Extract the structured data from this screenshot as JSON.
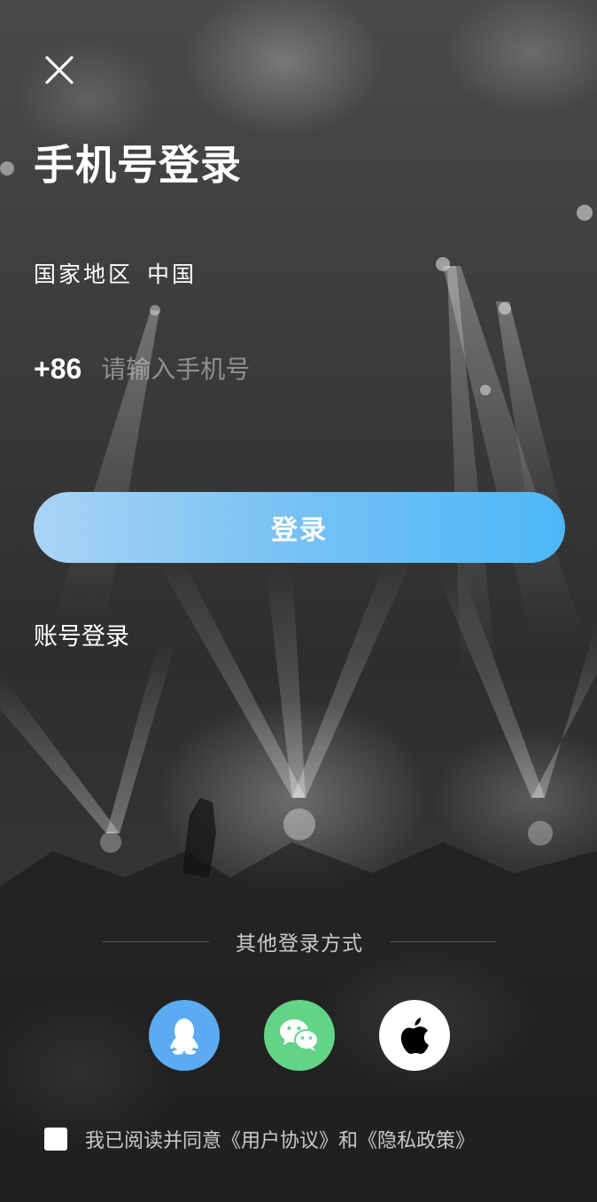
{
  "header": {
    "title": "手机号登录"
  },
  "region": {
    "label": "国家地区",
    "value": "中国"
  },
  "phone": {
    "country_code": "+86",
    "placeholder": "请输入手机号",
    "value": ""
  },
  "login_button": {
    "label": "登录",
    "gradient": [
      "#a9d4f5",
      "#4db8f7"
    ]
  },
  "account_login": {
    "label": "账号登录"
  },
  "other_login": {
    "label": "其他登录方式",
    "providers": [
      {
        "name": "qq",
        "icon": "qq-penguin-icon",
        "color": "#5aabf2"
      },
      {
        "name": "wechat",
        "icon": "wechat-icon",
        "color": "#62d487"
      },
      {
        "name": "apple",
        "icon": "apple-icon",
        "color": "#ffffff"
      }
    ]
  },
  "agreement": {
    "checked": false,
    "prefix": "我已阅读并同意",
    "user_agreement": "《用户协议》",
    "conjunction": "和",
    "privacy_policy": "《隐私政策》"
  }
}
